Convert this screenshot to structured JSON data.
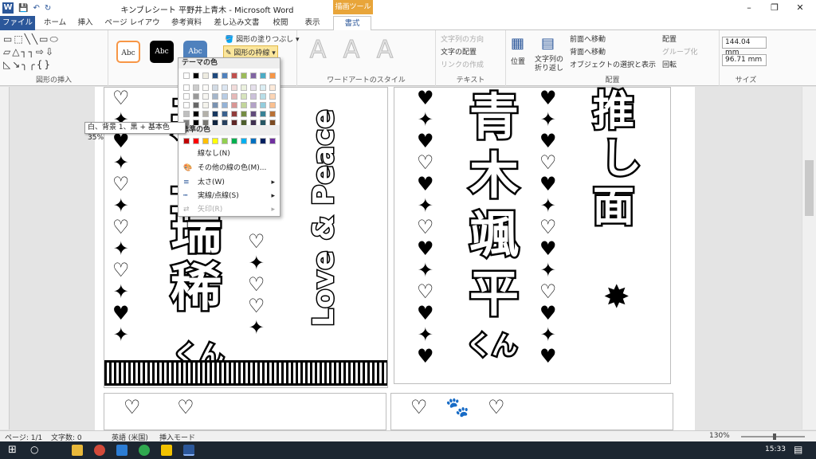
{
  "window": {
    "title": "キンブレシート 平野井上青木 - Microsoft Word",
    "context_group": "描画ツール",
    "controls": [
      "–",
      "❐",
      "✕"
    ]
  },
  "tabs": [
    "ファイル",
    "ホーム",
    "挿入",
    "ページ レイアウト",
    "参考資料",
    "差し込み文書",
    "校閲",
    "表示",
    "書式"
  ],
  "ribbon": {
    "groups": [
      "図形の挿入",
      "図形のスタイル",
      "ワードアートのスタイル",
      "テキスト",
      "配置",
      "サイズ"
    ],
    "style_samples": [
      "Abc",
      "Abc",
      "Abc"
    ],
    "shape_fill": "図形の塗りつぶし",
    "shape_outline": "図形の枠線",
    "wordart": [
      "A",
      "A",
      "A"
    ],
    "text_items": [
      "文字列の方向",
      "文字の配置",
      "リンクの作成"
    ],
    "position": "位置",
    "wrap": "文字列の折り返し",
    "arrange": [
      "前面へ移動",
      "背面へ移動",
      "オブジェクトの選択と表示"
    ],
    "arrange2": [
      "配置",
      "グループ化",
      "回転"
    ],
    "height": "144.04 mm",
    "width": "96.71 mm"
  },
  "dropdown": {
    "theme_title": "テーマの色",
    "standard_title": "標準の色",
    "no_line": "線なし(N)",
    "more": "その他の線の色(M)...",
    "weight": "太さ(W)",
    "dash": "実線/点線(S)",
    "arrow": "矢印(R)",
    "theme_row": [
      "#ffffff",
      "#000000",
      "#eeece1",
      "#1f497d",
      "#4f81bd",
      "#c0504d",
      "#9bbb59",
      "#8064a2",
      "#4bacc6",
      "#f79646"
    ],
    "standard_row": [
      "#c00000",
      "#ff0000",
      "#ffc000",
      "#ffff00",
      "#92d050",
      "#00b050",
      "#00b0f0",
      "#0070c0",
      "#002060",
      "#7030a0"
    ]
  },
  "tooltip": "白、背景 1、黒 + 基本色 35%",
  "document": {
    "card1_kanji": "井\n上\n瑞\n稀",
    "card1_suffix": "くん",
    "card2_text": "Love & Peace",
    "card3_kanji": "青\n木\n颯\n平",
    "card3_suffix": "くん",
    "card4_kanji": "推\n し\n面"
  },
  "status": {
    "page": "ページ: 1/1",
    "words": "文字数: 0",
    "lang": "英語 (米国)",
    "mode": "挿入モード",
    "zoom": "130%"
  },
  "taskbar": {
    "time": "15:33"
  }
}
